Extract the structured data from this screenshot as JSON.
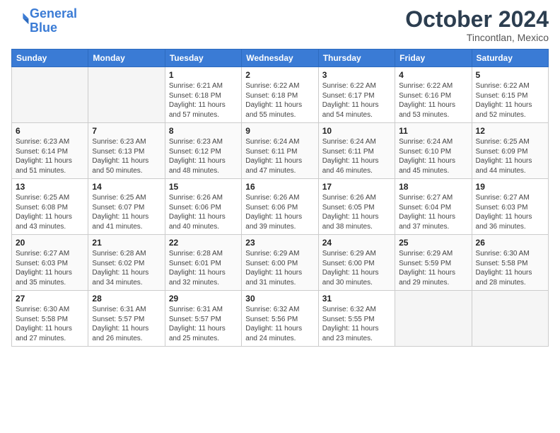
{
  "header": {
    "logo_line1": "General",
    "logo_line2": "Blue",
    "month_year": "October 2024",
    "location": "Tincontlan, Mexico"
  },
  "weekdays": [
    "Sunday",
    "Monday",
    "Tuesday",
    "Wednesday",
    "Thursday",
    "Friday",
    "Saturday"
  ],
  "weeks": [
    [
      {
        "day": "",
        "info": ""
      },
      {
        "day": "",
        "info": ""
      },
      {
        "day": "1",
        "info": "Sunrise: 6:21 AM\nSunset: 6:18 PM\nDaylight: 11 hours and 57 minutes."
      },
      {
        "day": "2",
        "info": "Sunrise: 6:22 AM\nSunset: 6:18 PM\nDaylight: 11 hours and 55 minutes."
      },
      {
        "day": "3",
        "info": "Sunrise: 6:22 AM\nSunset: 6:17 PM\nDaylight: 11 hours and 54 minutes."
      },
      {
        "day": "4",
        "info": "Sunrise: 6:22 AM\nSunset: 6:16 PM\nDaylight: 11 hours and 53 minutes."
      },
      {
        "day": "5",
        "info": "Sunrise: 6:22 AM\nSunset: 6:15 PM\nDaylight: 11 hours and 52 minutes."
      }
    ],
    [
      {
        "day": "6",
        "info": "Sunrise: 6:23 AM\nSunset: 6:14 PM\nDaylight: 11 hours and 51 minutes."
      },
      {
        "day": "7",
        "info": "Sunrise: 6:23 AM\nSunset: 6:13 PM\nDaylight: 11 hours and 50 minutes."
      },
      {
        "day": "8",
        "info": "Sunrise: 6:23 AM\nSunset: 6:12 PM\nDaylight: 11 hours and 48 minutes."
      },
      {
        "day": "9",
        "info": "Sunrise: 6:24 AM\nSunset: 6:11 PM\nDaylight: 11 hours and 47 minutes."
      },
      {
        "day": "10",
        "info": "Sunrise: 6:24 AM\nSunset: 6:11 PM\nDaylight: 11 hours and 46 minutes."
      },
      {
        "day": "11",
        "info": "Sunrise: 6:24 AM\nSunset: 6:10 PM\nDaylight: 11 hours and 45 minutes."
      },
      {
        "day": "12",
        "info": "Sunrise: 6:25 AM\nSunset: 6:09 PM\nDaylight: 11 hours and 44 minutes."
      }
    ],
    [
      {
        "day": "13",
        "info": "Sunrise: 6:25 AM\nSunset: 6:08 PM\nDaylight: 11 hours and 43 minutes."
      },
      {
        "day": "14",
        "info": "Sunrise: 6:25 AM\nSunset: 6:07 PM\nDaylight: 11 hours and 41 minutes."
      },
      {
        "day": "15",
        "info": "Sunrise: 6:26 AM\nSunset: 6:06 PM\nDaylight: 11 hours and 40 minutes."
      },
      {
        "day": "16",
        "info": "Sunrise: 6:26 AM\nSunset: 6:06 PM\nDaylight: 11 hours and 39 minutes."
      },
      {
        "day": "17",
        "info": "Sunrise: 6:26 AM\nSunset: 6:05 PM\nDaylight: 11 hours and 38 minutes."
      },
      {
        "day": "18",
        "info": "Sunrise: 6:27 AM\nSunset: 6:04 PM\nDaylight: 11 hours and 37 minutes."
      },
      {
        "day": "19",
        "info": "Sunrise: 6:27 AM\nSunset: 6:03 PM\nDaylight: 11 hours and 36 minutes."
      }
    ],
    [
      {
        "day": "20",
        "info": "Sunrise: 6:27 AM\nSunset: 6:03 PM\nDaylight: 11 hours and 35 minutes."
      },
      {
        "day": "21",
        "info": "Sunrise: 6:28 AM\nSunset: 6:02 PM\nDaylight: 11 hours and 34 minutes."
      },
      {
        "day": "22",
        "info": "Sunrise: 6:28 AM\nSunset: 6:01 PM\nDaylight: 11 hours and 32 minutes."
      },
      {
        "day": "23",
        "info": "Sunrise: 6:29 AM\nSunset: 6:00 PM\nDaylight: 11 hours and 31 minutes."
      },
      {
        "day": "24",
        "info": "Sunrise: 6:29 AM\nSunset: 6:00 PM\nDaylight: 11 hours and 30 minutes."
      },
      {
        "day": "25",
        "info": "Sunrise: 6:29 AM\nSunset: 5:59 PM\nDaylight: 11 hours and 29 minutes."
      },
      {
        "day": "26",
        "info": "Sunrise: 6:30 AM\nSunset: 5:58 PM\nDaylight: 11 hours and 28 minutes."
      }
    ],
    [
      {
        "day": "27",
        "info": "Sunrise: 6:30 AM\nSunset: 5:58 PM\nDaylight: 11 hours and 27 minutes."
      },
      {
        "day": "28",
        "info": "Sunrise: 6:31 AM\nSunset: 5:57 PM\nDaylight: 11 hours and 26 minutes."
      },
      {
        "day": "29",
        "info": "Sunrise: 6:31 AM\nSunset: 5:57 PM\nDaylight: 11 hours and 25 minutes."
      },
      {
        "day": "30",
        "info": "Sunrise: 6:32 AM\nSunset: 5:56 PM\nDaylight: 11 hours and 24 minutes."
      },
      {
        "day": "31",
        "info": "Sunrise: 6:32 AM\nSunset: 5:55 PM\nDaylight: 11 hours and 23 minutes."
      },
      {
        "day": "",
        "info": ""
      },
      {
        "day": "",
        "info": ""
      }
    ]
  ]
}
